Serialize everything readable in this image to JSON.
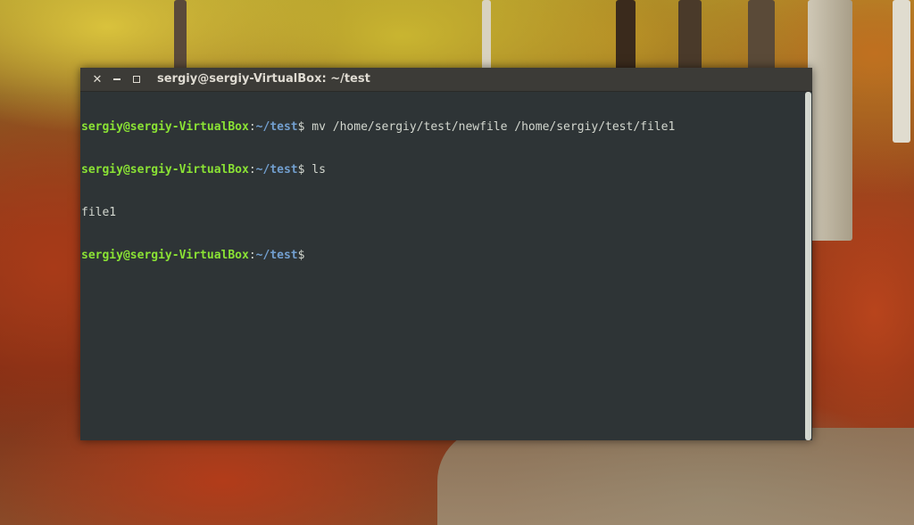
{
  "window": {
    "title": "sergiy@sergiy-VirtualBox: ~/test",
    "controls": {
      "close_icon": "close-icon",
      "minimize_icon": "minimize-icon",
      "maximize_icon": "maximize-icon"
    }
  },
  "terminal": {
    "colors": {
      "background": "#2e3436",
      "text": "#d3d7cf",
      "user": "#8ae234",
      "path": "#729fcf"
    },
    "lines": [
      {
        "user_host": "sergiy@sergiy-VirtualBox",
        "sep": ":",
        "path": "~/test",
        "prompt": "$",
        "command": " mv /home/sergiy/test/newfile /home/sergiy/test/file1"
      },
      {
        "user_host": "sergiy@sergiy-VirtualBox",
        "sep": ":",
        "path": "~/test",
        "prompt": "$",
        "command": " ls"
      },
      {
        "output": "file1"
      },
      {
        "user_host": "sergiy@sergiy-VirtualBox",
        "sep": ":",
        "path": "~/test",
        "prompt": "$",
        "command": ""
      }
    ]
  }
}
